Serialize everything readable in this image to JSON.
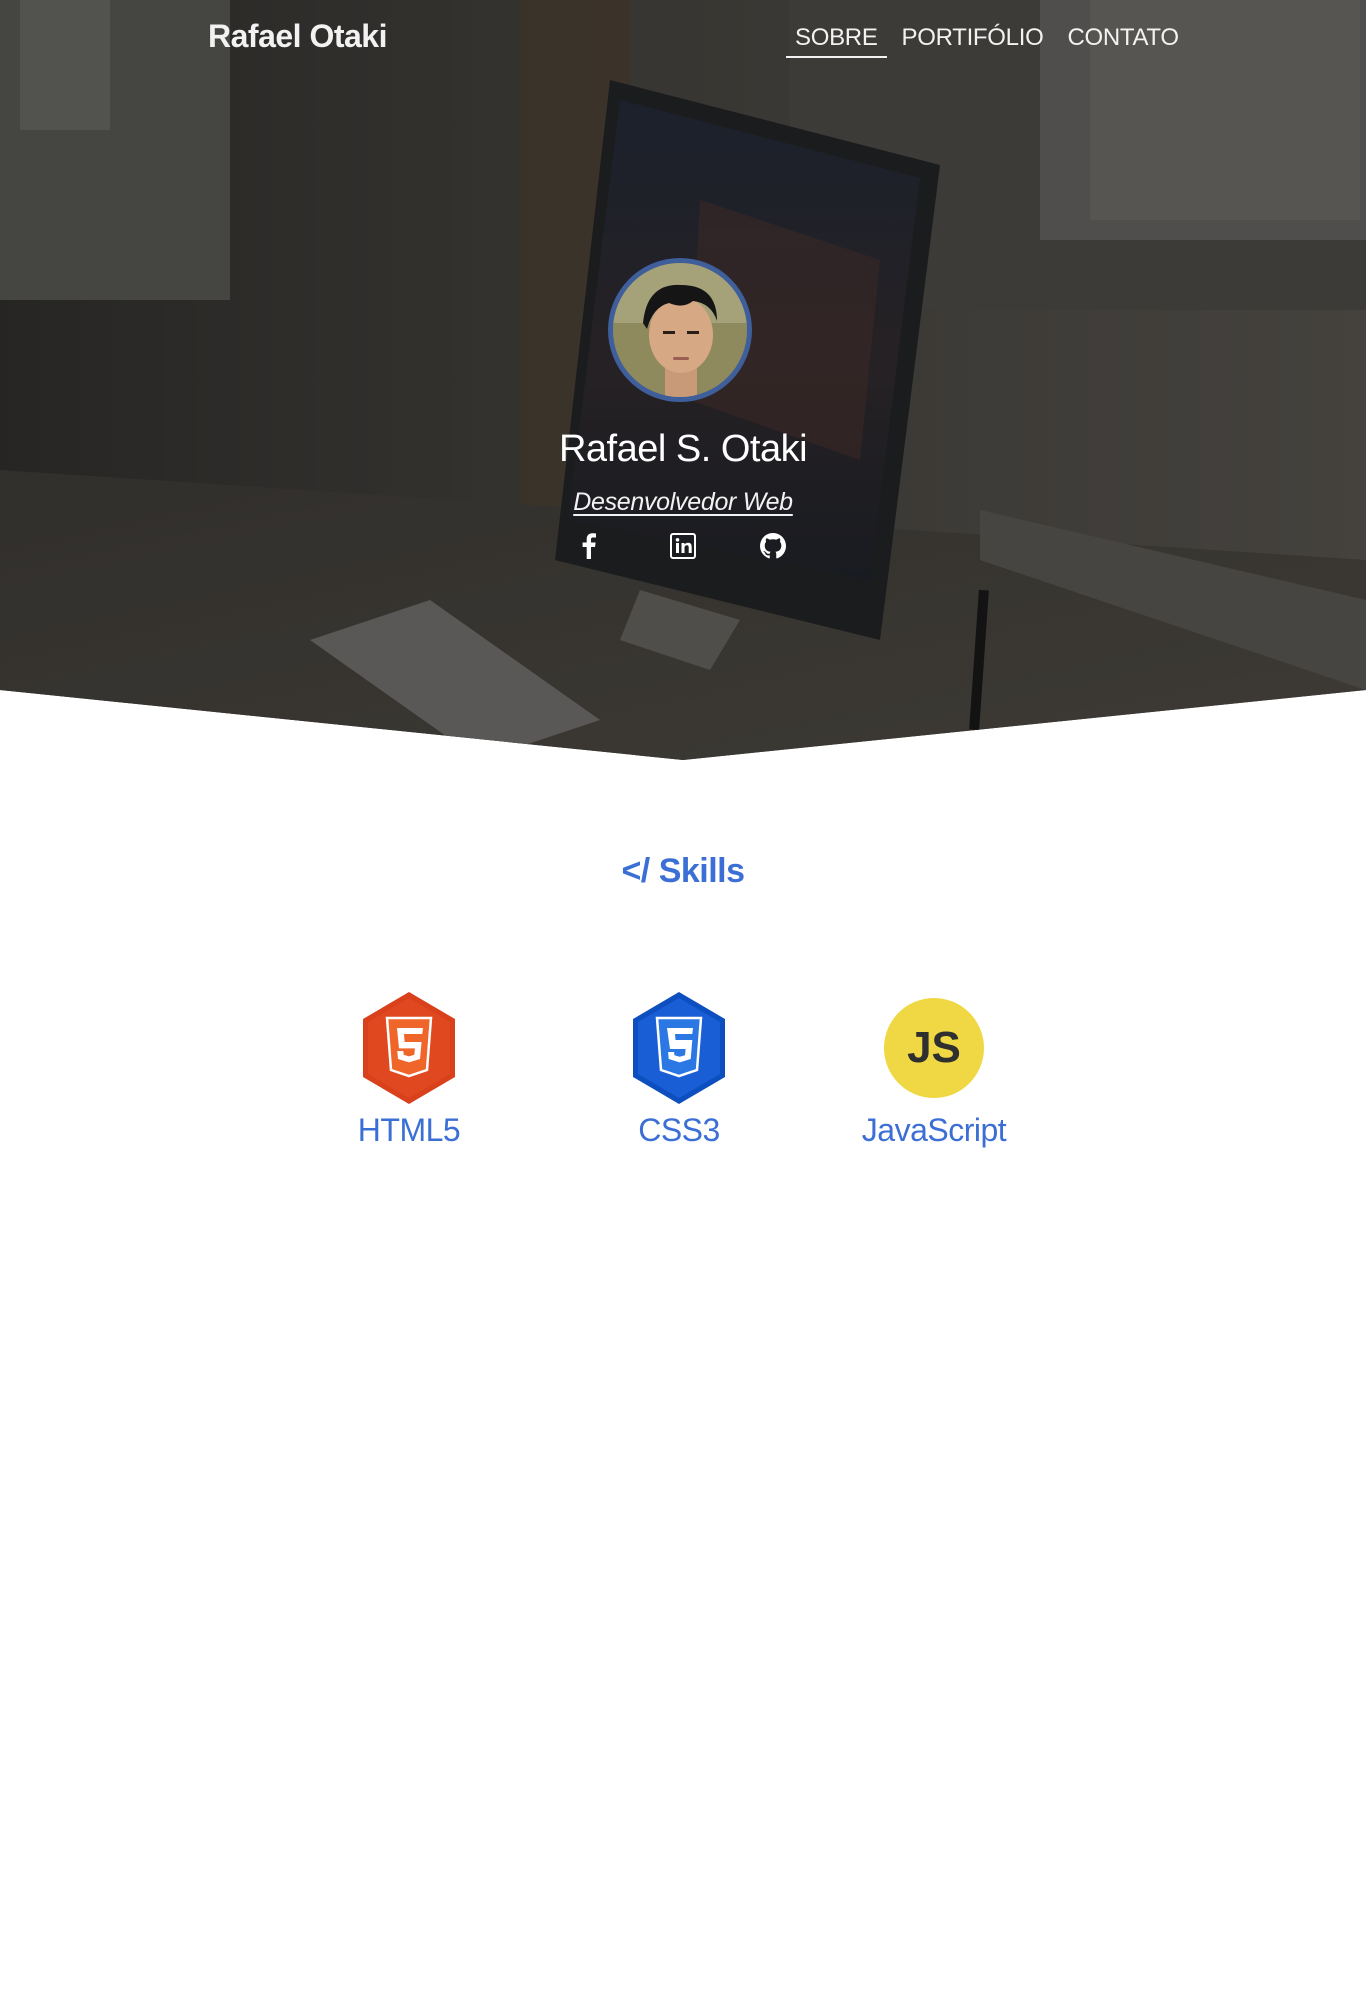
{
  "nav": {
    "brand": "Rafael Otaki",
    "links": [
      {
        "label": "SOBRE",
        "active": true
      },
      {
        "label": "PORTIFÓLIO",
        "active": false
      },
      {
        "label": "CONTATO",
        "active": false
      }
    ]
  },
  "hero": {
    "name": "Rafael S. Otaki",
    "role": "Desenvolvedor Web",
    "social": [
      {
        "icon": "facebook-icon"
      },
      {
        "icon": "linkedin-icon"
      },
      {
        "icon": "github-icon"
      }
    ]
  },
  "skills": {
    "title": "</ Skills",
    "items": [
      {
        "label": "HTML5",
        "icon": "html5-icon",
        "color": "#e34c26"
      },
      {
        "label": "CSS3",
        "icon": "css3-icon",
        "color": "#1572b6"
      },
      {
        "label": "JavaScript",
        "icon": "javascript-icon",
        "color": "#f0db4f"
      }
    ]
  },
  "colors": {
    "accent": "#3c6fd6",
    "avatar_ring": "#3f5e9c"
  }
}
